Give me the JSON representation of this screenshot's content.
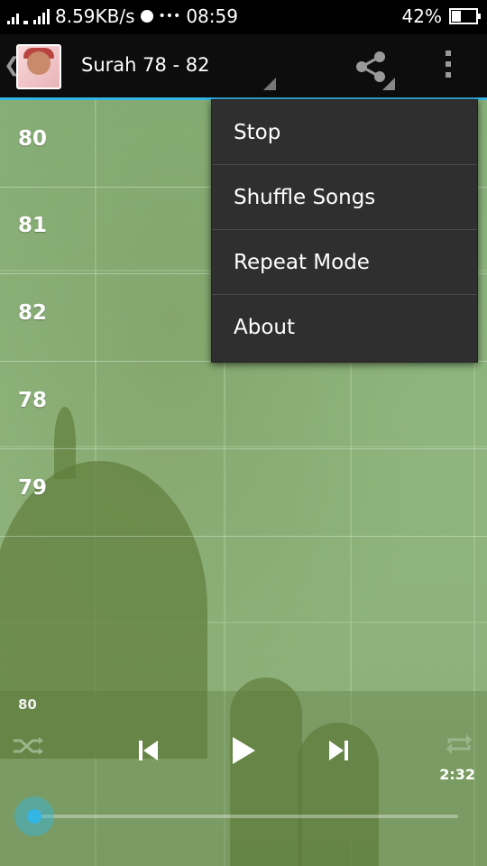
{
  "status_bar": {
    "net_speed": "8.59KB/s",
    "extra": "•••",
    "time": "08:59",
    "battery": "42%",
    "battery_level": 0.42
  },
  "action_bar": {
    "title": "Surah 78 - 82",
    "share_icon": "share-icon",
    "overflow_icon": "overflow-menu-icon"
  },
  "list": {
    "items": [
      {
        "label": "80"
      },
      {
        "label": "81"
      },
      {
        "label": "82"
      },
      {
        "label": "78"
      },
      {
        "label": "79"
      }
    ]
  },
  "menu": {
    "items": [
      {
        "label": "Stop"
      },
      {
        "label": "Shuffle Songs"
      },
      {
        "label": "Repeat Mode"
      },
      {
        "label": "About"
      }
    ]
  },
  "player": {
    "now_playing": "80",
    "elapsed": "2:32",
    "progress": 0.0,
    "accent": "#33b5e5"
  }
}
